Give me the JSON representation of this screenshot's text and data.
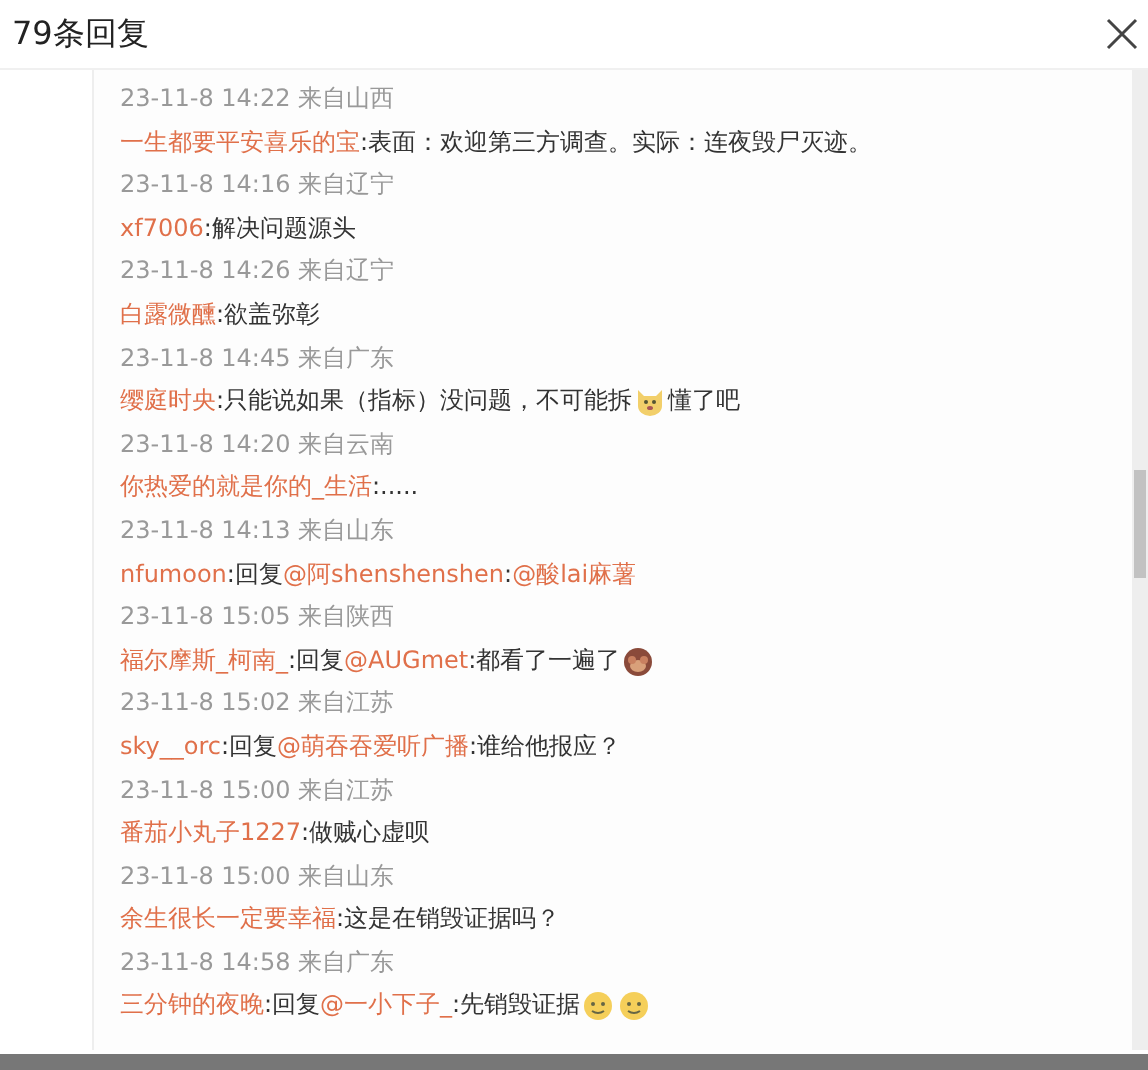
{
  "title": "79条回复",
  "replies": [
    {
      "time": "23-11-8 14:22 来自山西",
      "parts": [
        {
          "kind": "author",
          "text": "一生都要平安喜乐的宝"
        },
        {
          "kind": "text",
          "text": ":表面：欢迎第三方调查。实际：连夜毁尸灭迹。"
        }
      ]
    },
    {
      "time": "23-11-8 14:16 来自辽宁",
      "parts": [
        {
          "kind": "author",
          "text": "xf7006"
        },
        {
          "kind": "text",
          "text": ":解决问题源头"
        }
      ]
    },
    {
      "time": "23-11-8 14:26 来自辽宁",
      "parts": [
        {
          "kind": "author",
          "text": "白露微醺"
        },
        {
          "kind": "text",
          "text": ":欲盖弥彰"
        }
      ]
    },
    {
      "time": "23-11-8 14:45 来自广东",
      "parts": [
        {
          "kind": "author",
          "text": "缨庭时央"
        },
        {
          "kind": "text",
          "text": ":只能说如果（指标）没问题，不可能拆"
        },
        {
          "kind": "cat_emoji"
        },
        {
          "kind": "text",
          "text": "懂了吧"
        }
      ]
    },
    {
      "time": "23-11-8 14:20 来自云南",
      "parts": [
        {
          "kind": "author",
          "text": "你热爱的就是你的_生活"
        },
        {
          "kind": "text",
          "text": ":....."
        }
      ]
    },
    {
      "time": "23-11-8 14:13 来自山东",
      "parts": [
        {
          "kind": "author",
          "text": "nfumoon"
        },
        {
          "kind": "text",
          "text": ":回复"
        },
        {
          "kind": "mention",
          "text": "@阿shenshenshen"
        },
        {
          "kind": "text",
          "text": ":"
        },
        {
          "kind": "mention",
          "text": "@酸lai麻薯"
        }
      ]
    },
    {
      "time": "23-11-8 15:05 来自陕西",
      "parts": [
        {
          "kind": "author",
          "text": "福尔摩斯_柯南_"
        },
        {
          "kind": "text",
          "text": ":回复"
        },
        {
          "kind": "mention",
          "text": "@AUGmet"
        },
        {
          "kind": "text",
          "text": ":都看了一遍了"
        },
        {
          "kind": "monkey_emoji"
        }
      ]
    },
    {
      "time": "23-11-8 15:02 来自江苏",
      "parts": [
        {
          "kind": "author",
          "text": "sky__orc"
        },
        {
          "kind": "text",
          "text": ":回复"
        },
        {
          "kind": "mention",
          "text": "@萌吞吞爱听广播"
        },
        {
          "kind": "text",
          "text": ":谁给他报应？"
        }
      ]
    },
    {
      "time": "23-11-8 15:00 来自江苏",
      "parts": [
        {
          "kind": "author",
          "text": "番茄小丸子1227"
        },
        {
          "kind": "text",
          "text": ":做贼心虚呗"
        }
      ]
    },
    {
      "time": "23-11-8 15:00 来自山东",
      "parts": [
        {
          "kind": "author",
          "text": "余生很长一定要幸福"
        },
        {
          "kind": "text",
          "text": ":这是在销毁证据吗？"
        }
      ]
    },
    {
      "time": "23-11-8 14:58 来自广东",
      "parts": [
        {
          "kind": "author",
          "text": "三分钟的夜晚"
        },
        {
          "kind": "text",
          "text": ":回复"
        },
        {
          "kind": "mention",
          "text": "@一小下子_"
        },
        {
          "kind": "text",
          "text": ":先销毁证据"
        },
        {
          "kind": "face_emoji"
        },
        {
          "kind": "face_emoji"
        }
      ]
    }
  ]
}
